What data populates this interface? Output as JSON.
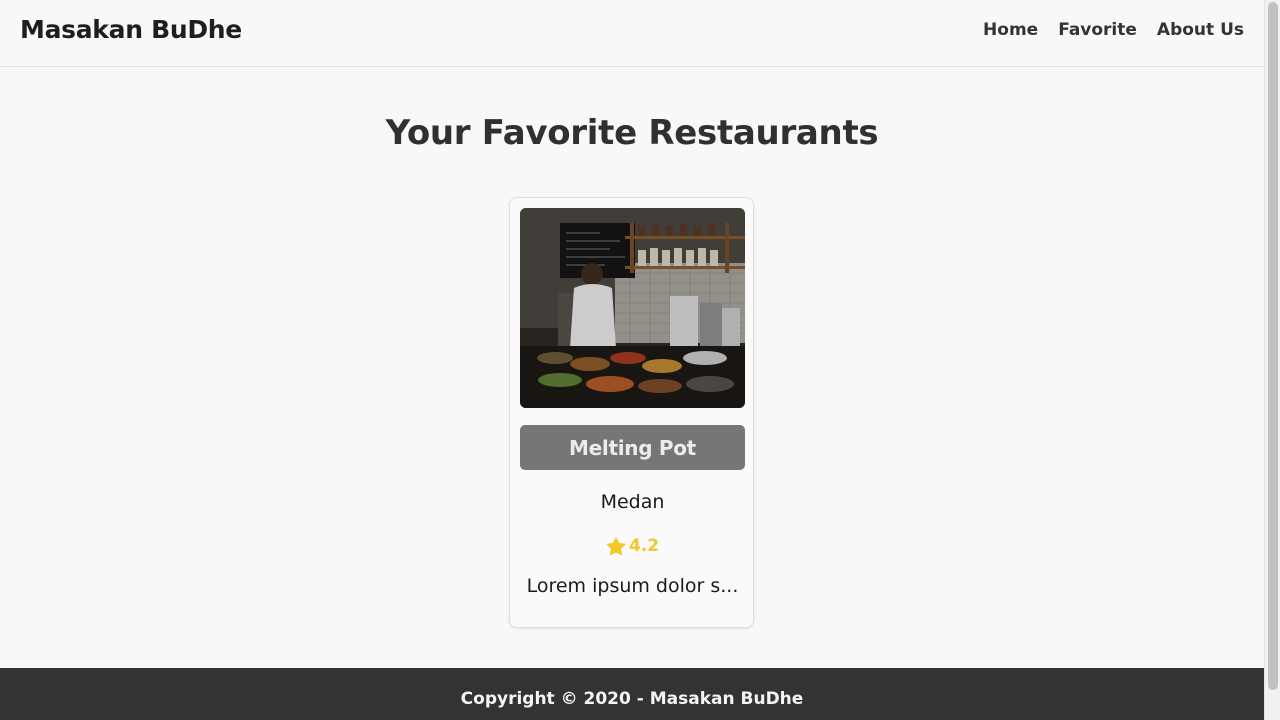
{
  "brand": "Masakan BuDhe",
  "nav": {
    "home": "Home",
    "favorite": "Favorite",
    "about": "About Us"
  },
  "page_title": "Your Favorite Restaurants",
  "restaurant": {
    "name": "Melting Pot",
    "city": "Medan",
    "rating": "4.2",
    "description": "Lorem ipsum dolor s..."
  },
  "footer": {
    "copyright": "Copyright © 2020 - Masakan BuDhe"
  },
  "colors": {
    "rating_star": "#f3c72a",
    "name_bar": "#767676",
    "footer_bg": "#333333"
  },
  "icons": {
    "rating": "star-icon"
  }
}
